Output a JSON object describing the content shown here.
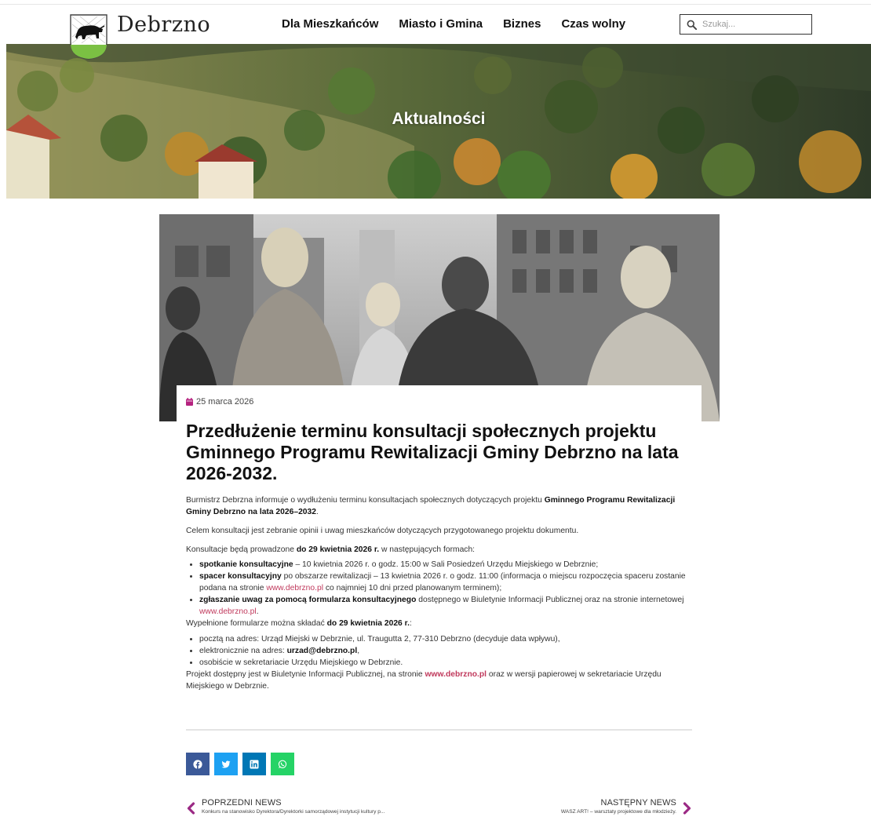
{
  "header": {
    "logo_text": "Debrzno",
    "nav": [
      "Dla Mieszkańców",
      "Miasto i Gmina",
      "Biznes",
      "Czas wolny"
    ],
    "search_placeholder": "Szukaj..."
  },
  "hero": {
    "title": "Aktualności"
  },
  "article": {
    "date": "25 marca 2026",
    "title": "Przedłużenie terminu konsultacji społecznych projektu Gminnego Programu Rewitalizacji Gminy Debrzno na lata 2026-2032.",
    "p1_start": "Burmistrz Debrzna informuje o wydłużeniu terminu konsultacjach społecznych dotyczących projektu ",
    "p1_bold": "Gminnego Programu Rewitalizacji Gminy Debrzno na lata 2026–2032",
    "p1_end": ".",
    "p2": "Celem konsultacji jest zebranie opinii i uwag mieszkańców dotyczących przygotowanego projektu dokumentu.",
    "p3_start": "Konsultacje będą prowadzone ",
    "p3_bold": "do 29 kwietnia 2026 r.",
    "p3_end": " w następujących formach:",
    "li1_bold": "spotkanie konsultacyjne",
    "li1_rest": " – 10 kwietnia 2026 r. o godz. 15:00 w Sali Posiedzeń Urzędu Miejskiego w Debrznie;",
    "li2_bold": "spacer konsultacyjny",
    "li2_rest": " po obszarze rewitalizacji – 13 kwietnia 2026 r. o godz. 11:00 (informacja o miejscu rozpoczęcia spaceru zostanie podana na stronie ",
    "li2_link": "www.debrzno.pl",
    "li2_end": " co najmniej 10 dni przed planowanym terminem);",
    "li3_bold": "zgłaszanie uwag za pomocą formularza konsultacyjnego",
    "li3_rest": " dostępnego w Biuletynie Informacji Publicznej oraz na stronie internetowej ",
    "li3_link": "www.debrzno.pl",
    "li3_end": ".",
    "p4_start": "Wypełnione formularze można składać ",
    "p4_bold": "do 29 kwietnia 2026 r.",
    "p4_end": ":",
    "li4": "pocztą na adres: Urząd Miejski w Debrznie, ul. Traugutta 2, 77-310 Debrzno (decyduje data wpływu),",
    "li5_start": "elektronicznie na adres: ",
    "li5_bold": "urzad@debrzno.pl",
    "li5_end": ",",
    "li6": "osobiście w sekretariacie Urzędu Miejskiego w Debrznie.",
    "p5_start": "Projekt dostępny jest w Biuletynie Informacji Publicznej, na stronie ",
    "p5_link": "www.debrzno.pl",
    "p5_end": " oraz w wersji papierowej w sekretariacie Urzędu Miejskiego w Debrznie."
  },
  "share": {
    "icons": [
      "facebook-icon",
      "twitter-icon",
      "linkedin-icon",
      "whatsapp-icon"
    ],
    "colors": [
      "#3b5998",
      "#1da1f2",
      "#0077b5",
      "#25d366"
    ]
  },
  "postnav": {
    "prev_label": "POPRZEDNI NEWS",
    "prev_title": "Konkurs na stanowisko Dyrektora/Dyrektorki samorządowej instytucji kultury p...",
    "next_label": "NASTĘPNY NEWS",
    "next_title": "WASZ ART! – warsztaty projektowe dla młodzieży."
  },
  "colors": {
    "accent": "#b5227f",
    "link": "#c0395c"
  }
}
